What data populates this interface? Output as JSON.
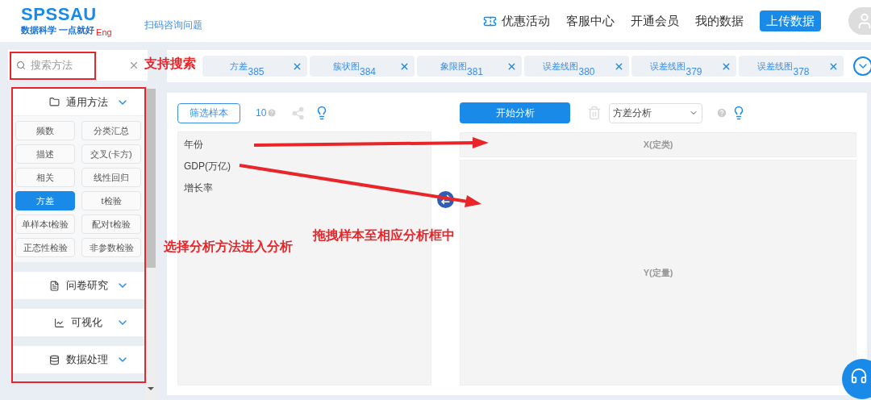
{
  "logo": {
    "title": "SPSSAU",
    "slogan": "数据科学 一点就好",
    "lang": "Eng"
  },
  "header_link": "扫码咨询问题",
  "nav": [
    {
      "label": "优惠活动",
      "kind": "promo"
    },
    {
      "label": "客服中心",
      "kind": "link"
    },
    {
      "label": "开通会员",
      "kind": "link"
    },
    {
      "label": "我的数据",
      "kind": "link"
    },
    {
      "label": "上传数据",
      "kind": "button"
    }
  ],
  "search": {
    "placeholder": "搜索方法"
  },
  "tabs": [
    {
      "label": "方差",
      "number": "385"
    },
    {
      "label": "簇状图",
      "number": "384"
    },
    {
      "label": "象限图",
      "number": "381"
    },
    {
      "label": "误差线图",
      "number": "380"
    },
    {
      "label": "误差线图",
      "number": "379"
    },
    {
      "label": "误差线图",
      "number": "378"
    }
  ],
  "sidebar": {
    "groups": [
      {
        "label": "通用方法",
        "kind": "general",
        "expanded": true,
        "methods": [
          {
            "label": "频数",
            "selected": false
          },
          {
            "label": "分类汇总",
            "selected": false
          },
          {
            "label": "描述",
            "selected": false
          },
          {
            "label": "交叉(卡方)",
            "selected": false
          },
          {
            "label": "相关",
            "selected": false
          },
          {
            "label": "线性回归",
            "selected": false
          },
          {
            "label": "方差",
            "selected": true
          },
          {
            "label": "t检验",
            "selected": false
          },
          {
            "label": "单样本t检验",
            "selected": false
          },
          {
            "label": "配对t检验",
            "selected": false
          },
          {
            "label": "正态性检验",
            "selected": false
          },
          {
            "label": "非参数检验",
            "selected": false
          }
        ]
      },
      {
        "label": "问卷研究",
        "kind": "general",
        "expanded": false
      },
      {
        "label": "可视化",
        "kind": "general",
        "expanded": false
      },
      {
        "label": "数据处理",
        "kind": "general",
        "expanded": false
      }
    ]
  },
  "toolbar": {
    "filter_button": "筛选样本",
    "count": "10"
  },
  "variables": [
    "年份",
    "GDP(万亿)",
    "增长率"
  ],
  "analysis": {
    "start_button": "开始分析",
    "method": "方差分析",
    "zones": [
      "X(定类)",
      "Y(定量)"
    ]
  },
  "annotations": [
    "支持搜索",
    "选择分析方法进入分析",
    "拖拽样本至相应分析框中"
  ]
}
